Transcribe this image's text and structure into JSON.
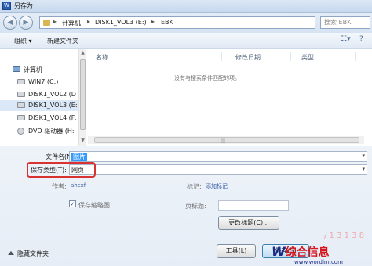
{
  "window": {
    "title": "另存为",
    "app_icon": "W"
  },
  "address": {
    "crumbs": [
      "计算机",
      "DISK1_VOL3 (E:)",
      "EBK"
    ],
    "separator": "▸",
    "search_placeholder": "搜索 EBK"
  },
  "toolbar": {
    "organize": "组织 ▾",
    "new_folder": "新建文件夹"
  },
  "nav": {
    "items": [
      {
        "label": "计算机",
        "icon": "computer-icon"
      },
      {
        "label": "WIN7 (C:)",
        "icon": "drive-icon"
      },
      {
        "label": "DISK1_VOL2 (D",
        "icon": "drive-icon"
      },
      {
        "label": "DISK1_VOL3 (E:",
        "icon": "drive-icon"
      },
      {
        "label": "DISK1_VOL4 (F:",
        "icon": "drive-icon"
      },
      {
        "label": "DVD 驱动器 (H:",
        "icon": "dvd-drive-icon"
      }
    ]
  },
  "filelist": {
    "columns": [
      "名称",
      "修改日期",
      "类型"
    ],
    "empty_message": "没有与搜索条件匹配的项。"
  },
  "form": {
    "filename_label": "文件名(N):",
    "filename_value": "图片",
    "filetype_label": "保存类型(T):",
    "filetype_value": "网页",
    "author_label": "作者:",
    "author_value": "ahcxf",
    "tags_label": "标记:",
    "tags_placeholder": "添加标记",
    "thumbnail_label": "保存缩略图",
    "page_title_label": "页标题:",
    "change_title_button": "更改标题(C)..."
  },
  "footer": {
    "hide_folders": "隐藏文件夹",
    "tools": "工具(L)",
    "save": "保存(S)"
  },
  "watermark": {
    "big_w": "W",
    "big_text": "综合信息",
    "small": "www.wordlm.com",
    "faint": "/ 1 3 1 3 8"
  }
}
